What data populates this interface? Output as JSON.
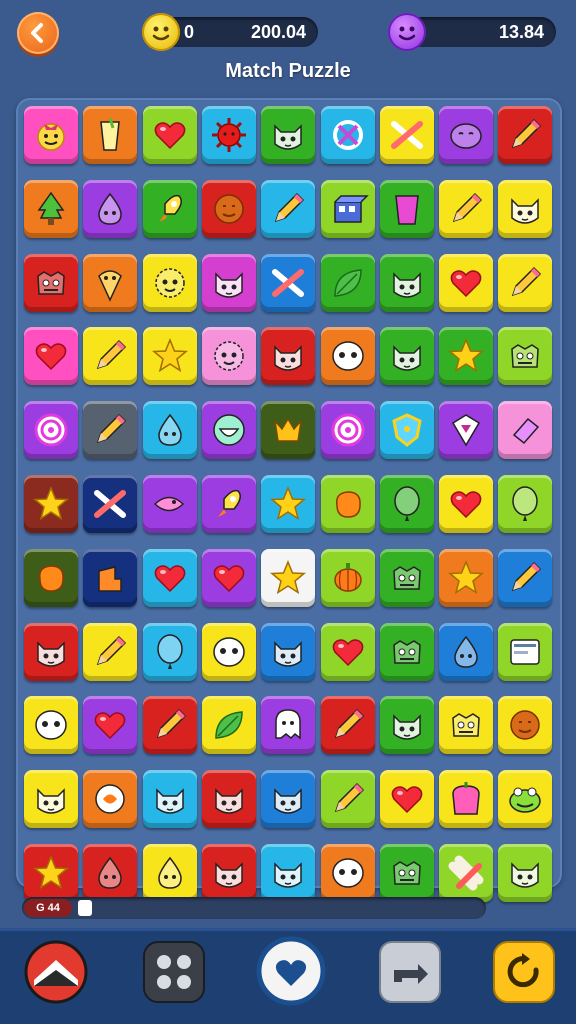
{
  "header": {
    "level_left": "0",
    "score": "200.04",
    "score_right": "13.84",
    "title": "Match Puzzle"
  },
  "progress": {
    "label": "G 44",
    "fraction": 0.02
  },
  "colors": {
    "pink": "#ff4fc1",
    "orange": "#f07a1e",
    "lime": "#8fd628",
    "red": "#d8221f",
    "green": "#33b024",
    "sky": "#27b6e8",
    "yellow": "#f7e41a",
    "purple": "#9b3de0",
    "blue": "#1e7ed8",
    "darkred": "#8b2a1e",
    "navy": "#14307e",
    "olive": "#3e5d18",
    "white": "#f5f5f5",
    "darkgray": "#3c3c3c",
    "gray": "#566270",
    "lightpink": "#f592d9",
    "magenta": "#d43fcf"
  },
  "grid": [
    [
      {
        "c": "pink",
        "i": "face-icon"
      },
      {
        "c": "orange",
        "i": "drink-icon"
      },
      {
        "c": "lime",
        "i": "heart-icon"
      },
      {
        "c": "sky",
        "i": "spiky-ball-icon"
      },
      {
        "c": "green",
        "i": "cat-face-icon"
      },
      {
        "c": "sky",
        "i": "no-sign-icon"
      },
      {
        "c": "yellow",
        "i": "crossed-pencils-icon"
      },
      {
        "c": "purple",
        "i": "blob-face-icon"
      },
      {
        "c": "red",
        "i": "pencil-icon"
      }
    ],
    [
      {
        "c": "orange",
        "i": "tree-icon"
      },
      {
        "c": "purple",
        "i": "drop-icon"
      },
      {
        "c": "green",
        "i": "rocket-icon"
      },
      {
        "c": "red",
        "i": "cookie-face-icon"
      },
      {
        "c": "sky",
        "i": "pencil-icon"
      },
      {
        "c": "lime",
        "i": "box-icon"
      },
      {
        "c": "green",
        "i": "cup-icon"
      },
      {
        "c": "yellow",
        "i": "pencil-icon"
      },
      {
        "c": "yellow",
        "i": "cat-face-icon"
      }
    ],
    [
      {
        "c": "red",
        "i": "monster-icon"
      },
      {
        "c": "orange",
        "i": "cone-icon"
      },
      {
        "c": "yellow",
        "i": "fuzzy-face-icon"
      },
      {
        "c": "magenta",
        "i": "cat-face-icon"
      },
      {
        "c": "blue",
        "i": "crossed-pencils-icon"
      },
      {
        "c": "green",
        "i": "leaf-icon"
      },
      {
        "c": "green",
        "i": "cat-face-icon"
      },
      {
        "c": "yellow",
        "i": "heart-icon"
      },
      {
        "c": "yellow",
        "i": "pencil-icon"
      }
    ],
    [
      {
        "c": "pink",
        "i": "heart-icon"
      },
      {
        "c": "yellow",
        "i": "pencil-icon"
      },
      {
        "c": "yellow",
        "i": "star-icon"
      },
      {
        "c": "lightpink",
        "i": "fuzzy-face-icon"
      },
      {
        "c": "red",
        "i": "cat-face-icon"
      },
      {
        "c": "orange",
        "i": "eyes-icon"
      },
      {
        "c": "green",
        "i": "cat-face-icon"
      },
      {
        "c": "green",
        "i": "star-icon"
      },
      {
        "c": "lime",
        "i": "monster-icon"
      }
    ],
    [
      {
        "c": "purple",
        "i": "target-icon"
      },
      {
        "c": "gray",
        "i": "pencil-icon"
      },
      {
        "c": "sky",
        "i": "drop-icon"
      },
      {
        "c": "purple",
        "i": "smile-icon"
      },
      {
        "c": "olive",
        "i": "crown-icon"
      },
      {
        "c": "purple",
        "i": "target-icon"
      },
      {
        "c": "sky",
        "i": "shield-icon"
      },
      {
        "c": "purple",
        "i": "diamond-icon"
      },
      {
        "c": "lightpink",
        "i": "eraser-icon"
      }
    ],
    [
      {
        "c": "darkred",
        "i": "star-icon"
      },
      {
        "c": "navy",
        "i": "crossed-pencils-icon"
      },
      {
        "c": "purple",
        "i": "fish-icon"
      },
      {
        "c": "purple",
        "i": "rocket-icon"
      },
      {
        "c": "sky",
        "i": "star-icon"
      },
      {
        "c": "lime",
        "i": "blob-icon"
      },
      {
        "c": "green",
        "i": "balloon-icon"
      },
      {
        "c": "yellow",
        "i": "heart-icon"
      },
      {
        "c": "lime",
        "i": "balloon-icon"
      }
    ],
    [
      {
        "c": "olive",
        "i": "blob-icon"
      },
      {
        "c": "navy",
        "i": "chair-icon"
      },
      {
        "c": "sky",
        "i": "heart-icon"
      },
      {
        "c": "purple",
        "i": "heart-icon"
      },
      {
        "c": "white",
        "i": "star-icon"
      },
      {
        "c": "lime",
        "i": "pumpkin-icon"
      },
      {
        "c": "green",
        "i": "monster-icon"
      },
      {
        "c": "orange",
        "i": "star-icon"
      },
      {
        "c": "blue",
        "i": "pencil-icon"
      }
    ],
    [
      {
        "c": "red",
        "i": "cat-face-icon"
      },
      {
        "c": "yellow",
        "i": "pencil-icon"
      },
      {
        "c": "sky",
        "i": "balloon-icon"
      },
      {
        "c": "yellow",
        "i": "eyes-icon"
      },
      {
        "c": "blue",
        "i": "cat-face-icon"
      },
      {
        "c": "lime",
        "i": "heart-icon"
      },
      {
        "c": "green",
        "i": "monster-icon"
      },
      {
        "c": "blue",
        "i": "drop-icon"
      },
      {
        "c": "lime",
        "i": "card-icon"
      }
    ],
    [
      {
        "c": "yellow",
        "i": "eyes-icon"
      },
      {
        "c": "purple",
        "i": "heart-icon"
      },
      {
        "c": "red",
        "i": "pencil-icon"
      },
      {
        "c": "yellow",
        "i": "leaf-icon"
      },
      {
        "c": "purple",
        "i": "ghost-icon"
      },
      {
        "c": "red",
        "i": "pencil-icon"
      },
      {
        "c": "green",
        "i": "cat-face-icon"
      },
      {
        "c": "yellow",
        "i": "monster-icon"
      },
      {
        "c": "yellow",
        "i": "cookie-face-icon"
      }
    ],
    [
      {
        "c": "yellow",
        "i": "cat-face-icon"
      },
      {
        "c": "orange",
        "i": "bubble-icon"
      },
      {
        "c": "sky",
        "i": "cat-face-icon"
      },
      {
        "c": "red",
        "i": "cat-face-icon"
      },
      {
        "c": "blue",
        "i": "cat-face-icon"
      },
      {
        "c": "lime",
        "i": "pencil-icon"
      },
      {
        "c": "yellow",
        "i": "heart-icon"
      },
      {
        "c": "yellow",
        "i": "toast-icon"
      },
      {
        "c": "yellow",
        "i": "frog-icon"
      }
    ],
    [
      {
        "c": "red",
        "i": "star-icon"
      },
      {
        "c": "red",
        "i": "drop-icon"
      },
      {
        "c": "yellow",
        "i": "drop-icon"
      },
      {
        "c": "red",
        "i": "cat-face-icon"
      },
      {
        "c": "sky",
        "i": "cat-face-icon"
      },
      {
        "c": "orange",
        "i": "eyes-icon"
      },
      {
        "c": "green",
        "i": "monster-icon"
      },
      {
        "c": "lime",
        "i": "bandage-icon"
      },
      {
        "c": "lime",
        "i": "cat-face-icon"
      }
    ]
  ],
  "bottom": [
    {
      "name": "home-icon",
      "bg": "#e23a2e"
    },
    {
      "name": "grid-icon",
      "bg": "#3a3f48"
    },
    {
      "name": "heart-icon",
      "bg": "#f4f4f4"
    },
    {
      "name": "shuffle-icon",
      "bg": "#c9ced6"
    },
    {
      "name": "refresh-icon",
      "bg": "#ffc21a"
    }
  ]
}
